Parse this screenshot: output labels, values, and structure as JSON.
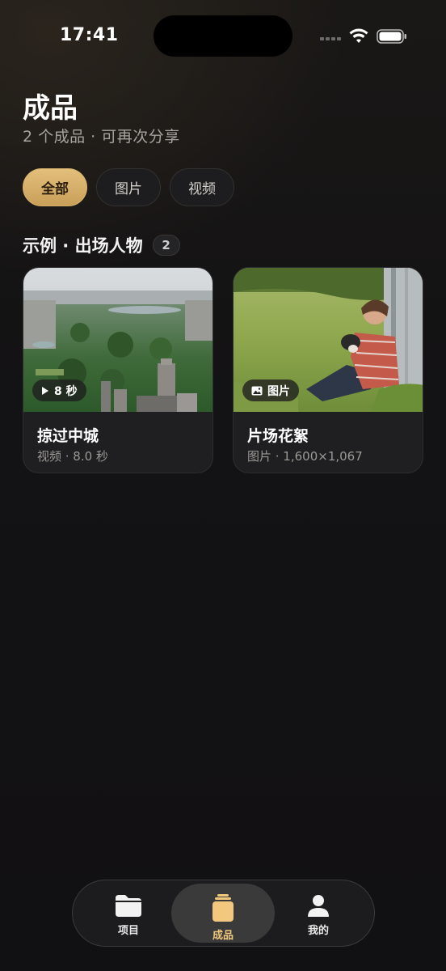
{
  "status_bar": {
    "time": "17:41"
  },
  "header": {
    "title": "成品",
    "subtitle": "2 个成品 · 可再次分享"
  },
  "filters": [
    {
      "label": "全部",
      "selected": true
    },
    {
      "label": "图片",
      "selected": false
    },
    {
      "label": "视频",
      "selected": false
    }
  ],
  "section": {
    "title": "示例 · 出场人物",
    "count": "2"
  },
  "cards": [
    {
      "title": "掠过中城",
      "meta": "视频 · 8.0 秒",
      "badge": "8 秒",
      "badge_icon": "play-icon",
      "thumbnail": "aerial-city-park"
    },
    {
      "title": "片场花絮",
      "meta": "图片 · 1,600×1,067",
      "badge": "图片",
      "badge_icon": "image-icon",
      "thumbnail": "man-with-dog-in-grass"
    }
  ],
  "tabbar": {
    "items": [
      {
        "label": "项目",
        "icon": "folder-icon",
        "active": false
      },
      {
        "label": "成品",
        "icon": "stack-icon",
        "active": true
      },
      {
        "label": "我的",
        "icon": "person-icon",
        "active": false
      }
    ]
  },
  "colors": {
    "accent": "#d9b36e",
    "tab_active_text": "#f1c87e",
    "background": "#121114"
  }
}
